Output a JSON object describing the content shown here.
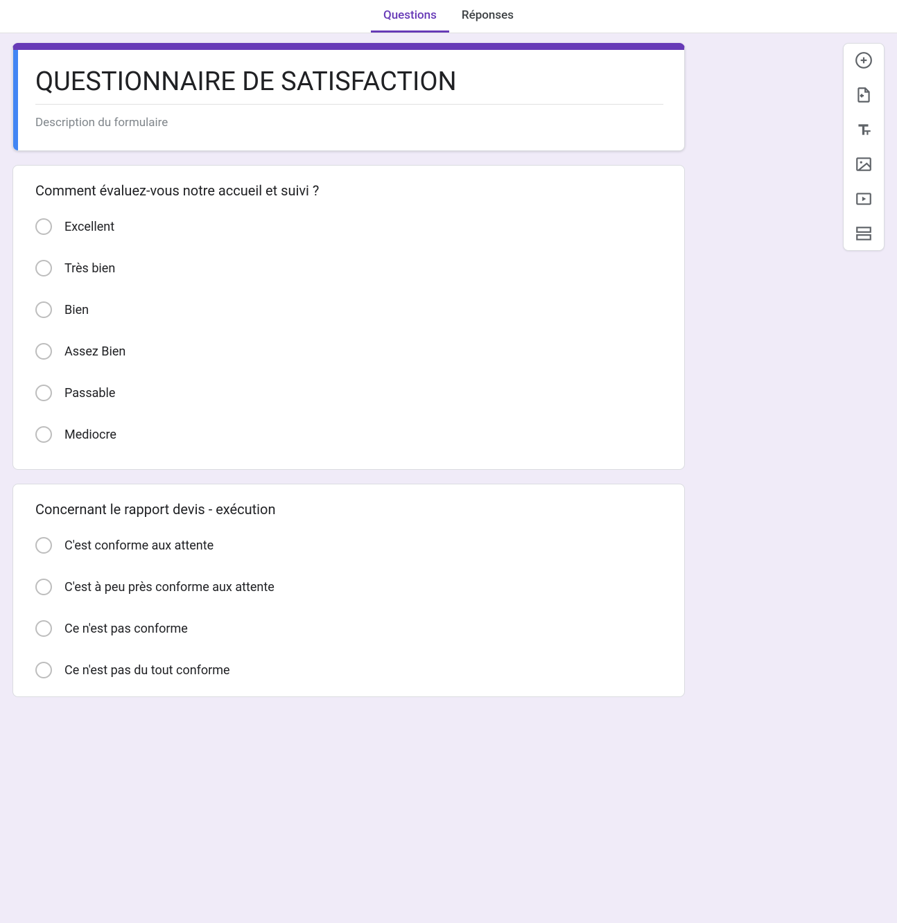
{
  "tabs": {
    "questions": "Questions",
    "responses": "Réponses"
  },
  "header": {
    "title": "QUESTIONNAIRE DE SATISFACTION",
    "description": "Description du formulaire"
  },
  "questions": [
    {
      "title": "Comment évaluez-vous notre accueil et suivi ?",
      "options": [
        "Excellent",
        "Très bien",
        "Bien",
        "Assez Bien",
        "Passable",
        "Mediocre"
      ]
    },
    {
      "title": "Concernant le rapport devis - exécution",
      "options": [
        "C'est conforme aux attente",
        "C'est à peu près conforme aux attente",
        "Ce n'est pas conforme",
        "Ce n'est pas du tout conforme"
      ]
    }
  ],
  "sidebar": {
    "add_question": "add-question",
    "import_questions": "import-questions",
    "add_title": "add-title",
    "add_image": "add-image",
    "add_video": "add-video",
    "add_section": "add-section"
  },
  "colors": {
    "accent": "#673ab7",
    "selection": "#4285f4",
    "background": "#f0ebf8"
  }
}
